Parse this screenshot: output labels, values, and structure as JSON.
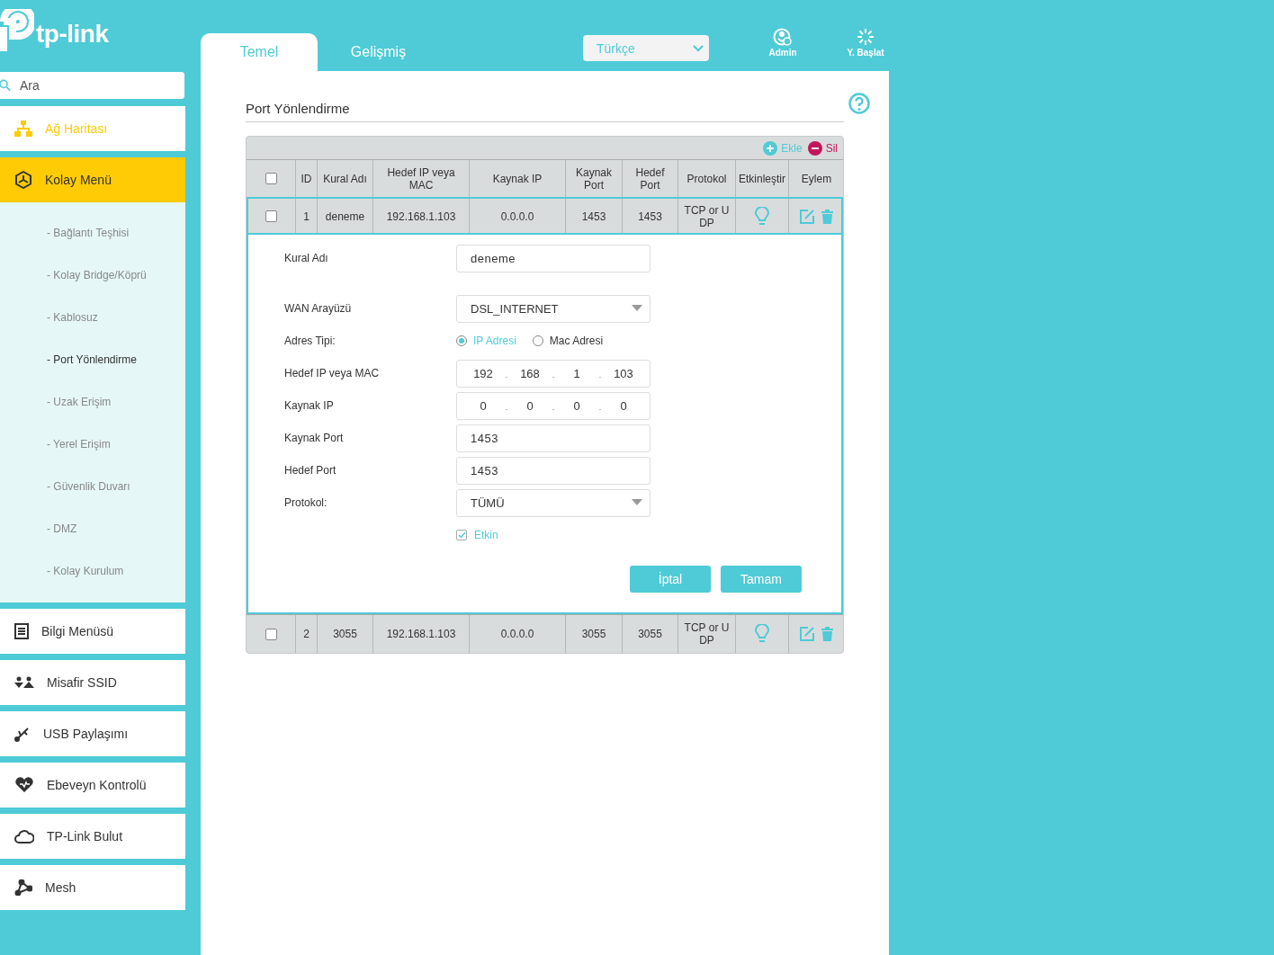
{
  "brand": {
    "logo_text": "tp-link"
  },
  "search": {
    "placeholder": "Ara"
  },
  "nav": [
    {
      "label": "Ağ Haritası",
      "selected": false,
      "highlighted": true
    },
    {
      "label": "Kolay Menü",
      "selected": true,
      "highlighted": false,
      "expanded": true,
      "children": [
        {
          "label": "- Bağlantı Teşhisi",
          "selected": false
        },
        {
          "label": "- Kolay Bridge/Köprü",
          "selected": false
        },
        {
          "label": "- Kablosuz",
          "selected": false
        },
        {
          "label": "- Port Yönlendirme",
          "selected": true
        },
        {
          "label": "- Uzak Erişim",
          "selected": false
        },
        {
          "label": "- Yerel Erişim",
          "selected": false
        },
        {
          "label": "- Güvenlik Duvarı",
          "selected": false
        },
        {
          "label": "- DMZ",
          "selected": false
        },
        {
          "label": "- Kolay Kurulum",
          "selected": false
        }
      ]
    },
    {
      "label": "Bilgi Menüsü",
      "selected": false,
      "highlighted": false
    },
    {
      "label": "Misafir SSID",
      "selected": false,
      "highlighted": false
    },
    {
      "label": "USB Paylaşımı",
      "selected": false,
      "highlighted": false
    },
    {
      "label": "Ebeveyn Kontrolü",
      "selected": false,
      "highlighted": false
    },
    {
      "label": "TP-Link Bulut",
      "selected": false,
      "highlighted": false
    },
    {
      "label": "Mesh",
      "selected": false,
      "highlighted": false
    }
  ],
  "tabs": [
    {
      "label": "Temel",
      "selected": true
    },
    {
      "label": "Gelişmiş",
      "selected": false
    }
  ],
  "language": {
    "value": "Türkçe"
  },
  "header_actions": [
    {
      "label": "Admin"
    },
    {
      "label": "Y. Başlat"
    }
  ],
  "page_title": "Port Yönlendirme",
  "table": {
    "toolbar": [
      {
        "kind": "add",
        "label": "Ekle"
      },
      {
        "kind": "delete",
        "label": "Sil"
      }
    ],
    "columns": [
      "ID",
      "Kural Adı",
      "Hedef IP veya MAC",
      "Kaynak IP",
      "Kaynak Port",
      "Hedef Port",
      "Protokol",
      "Etkinleştir",
      "Eylem"
    ],
    "header_checked": false,
    "rows": [
      {
        "checked": false,
        "enabled": true,
        "expanded": true,
        "cells": [
          "1",
          "deneme",
          "192.168.1.103",
          "0.0.0.0",
          "1453",
          "1453",
          "TCP or UDP"
        ]
      },
      {
        "checked": false,
        "enabled": true,
        "expanded": false,
        "cells": [
          "2",
          "3055",
          "192.168.1.103",
          "0.0.0.0",
          "3055",
          "3055",
          "TCP or UDP"
        ]
      }
    ]
  },
  "editor": {
    "fields": [
      {
        "kind": "text",
        "label": "Kural Adı",
        "value": "deneme"
      },
      {
        "kind": "select",
        "label": "WAN Arayüzü",
        "value": "DSL_INTERNET"
      },
      {
        "kind": "radio",
        "label": "Adres Tipi:",
        "options": [
          {
            "label": "IP Adresi",
            "selected": true
          },
          {
            "label": "Mac Adresi",
            "selected": false
          }
        ]
      },
      {
        "kind": "ip",
        "label": "Hedef IP veya MAC",
        "separator": ".",
        "octets": [
          "192",
          "168",
          "1",
          "103"
        ]
      },
      {
        "kind": "ip",
        "label": "Kaynak IP",
        "separator": ".",
        "octets": [
          "0",
          "0",
          "0",
          "0"
        ]
      },
      {
        "kind": "text",
        "label": "Kaynak Port",
        "value": "1453"
      },
      {
        "kind": "text",
        "label": "Hedef Port",
        "value": "1453"
      },
      {
        "kind": "select",
        "label": "Protokol:",
        "value": "TÜMÜ"
      },
      {
        "kind": "checkbox",
        "label": "Etkin",
        "checked": true
      }
    ],
    "buttons": [
      {
        "label": "İptal"
      },
      {
        "label": "Tamam"
      }
    ]
  }
}
